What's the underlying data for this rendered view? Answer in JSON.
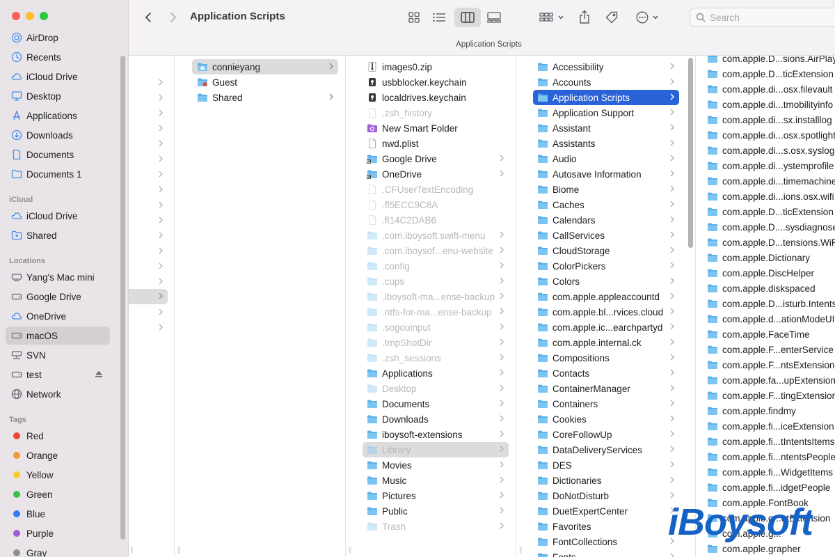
{
  "window": {
    "traffic_colors": [
      "#fe5f57",
      "#febc2e",
      "#28c840"
    ]
  },
  "toolbar": {
    "title": "Application Scripts",
    "path_label": "Application Scripts",
    "search_placeholder": "Search"
  },
  "sidebar": {
    "favorites": [
      {
        "label": "AirDrop",
        "icon": "airdrop-icon"
      },
      {
        "label": "Recents",
        "icon": "clock-icon"
      },
      {
        "label": "iCloud Drive",
        "icon": "cloud-icon"
      },
      {
        "label": "Desktop",
        "icon": "desktop-icon"
      },
      {
        "label": "Applications",
        "icon": "applications-icon"
      },
      {
        "label": "Downloads",
        "icon": "download-icon"
      },
      {
        "label": "Documents",
        "icon": "document-icon"
      },
      {
        "label": "Documents 1",
        "icon": "folder-icon"
      }
    ],
    "icloud_header": "iCloud",
    "icloud": [
      {
        "label": "iCloud Drive",
        "icon": "cloud-icon"
      },
      {
        "label": "Shared",
        "icon": "shared-folder-icon"
      }
    ],
    "locations_header": "Locations",
    "locations": [
      {
        "label": "Yang's Mac mini",
        "icon": "computer-icon"
      },
      {
        "label": "Google Drive",
        "icon": "drive-icon"
      },
      {
        "label": "OneDrive",
        "icon": "cloud-icon"
      },
      {
        "label": "macOS",
        "icon": "disk-icon",
        "selected": true
      },
      {
        "label": "SVN",
        "icon": "network-drive-icon"
      },
      {
        "label": "test",
        "icon": "disk-icon",
        "eject": true
      },
      {
        "label": "Network",
        "icon": "globe-icon"
      }
    ],
    "tags_header": "Tags",
    "tags": [
      {
        "label": "Red",
        "color": "#f0453a"
      },
      {
        "label": "Orange",
        "color": "#f29a2e"
      },
      {
        "label": "Yellow",
        "color": "#f7cb2d"
      },
      {
        "label": "Green",
        "color": "#3dbf4a"
      },
      {
        "label": "Blue",
        "color": "#2f7cf6"
      },
      {
        "label": "Purple",
        "color": "#a25fd6"
      },
      {
        "label": "Gray",
        "color": "#8e8e93"
      }
    ]
  },
  "columns": {
    "users": [
      {
        "label": "connieyang",
        "icon": "home-folder-icon",
        "selected": true,
        "chevron": true
      },
      {
        "label": "Guest",
        "icon": "guest-folder-icon",
        "chevron": false
      },
      {
        "label": "Shared",
        "icon": "folder-icon",
        "chevron": true
      }
    ],
    "home": [
      {
        "label": "images0.zip",
        "icon": "zip-icon",
        "dim": false,
        "chevron": false
      },
      {
        "label": "usbblocker.keychain",
        "icon": "keychain-icon",
        "dim": false,
        "chevron": false
      },
      {
        "label": "localdrives.keychain",
        "icon": "keychain-icon",
        "dim": false,
        "chevron": false
      },
      {
        "label": ".zsh_history",
        "icon": "file-icon",
        "dim": true,
        "chevron": false
      },
      {
        "label": "New Smart Folder",
        "icon": "smart-folder-icon",
        "dim": false,
        "chevron": false
      },
      {
        "label": "nwd.plist",
        "icon": "file-icon",
        "dim": false,
        "chevron": false
      },
      {
        "label": "Google Drive",
        "icon": "alias-folder-icon",
        "dim": false,
        "chevron": true
      },
      {
        "label": "OneDrive",
        "icon": "alias-folder-icon",
        "dim": false,
        "chevron": true
      },
      {
        "label": ".CFUserTextEncoding",
        "icon": "file-icon",
        "dim": true,
        "chevron": false
      },
      {
        "label": ".fl5ECC9C8A",
        "icon": "file-icon",
        "dim": true,
        "chevron": false
      },
      {
        "label": ".fl14C2DAB6",
        "icon": "file-icon",
        "dim": true,
        "chevron": false
      },
      {
        "label": ".com.iboysoft.swift-menu",
        "icon": "folder-icon",
        "dim": true,
        "chevron": true
      },
      {
        "label": ".com.iboysof...enu-website",
        "icon": "folder-icon",
        "dim": true,
        "chevron": true
      },
      {
        "label": ".config",
        "icon": "folder-icon",
        "dim": true,
        "chevron": true
      },
      {
        "label": ".cups",
        "icon": "folder-icon",
        "dim": true,
        "chevron": true
      },
      {
        "label": ".iboysoft-ma...ense-backup",
        "icon": "folder-icon",
        "dim": true,
        "chevron": true
      },
      {
        "label": ".ntfs-for-ma...ense-backup",
        "icon": "folder-icon",
        "dim": true,
        "chevron": true
      },
      {
        "label": ".sogouinput",
        "icon": "folder-icon",
        "dim": true,
        "chevron": true
      },
      {
        "label": ".tmpShotDir",
        "icon": "folder-icon",
        "dim": true,
        "chevron": true
      },
      {
        "label": ".zsh_sessions",
        "icon": "folder-icon",
        "dim": true,
        "chevron": true
      },
      {
        "label": "Applications",
        "icon": "folder-icon",
        "dim": false,
        "chevron": true
      },
      {
        "label": "Desktop",
        "icon": "folder-icon",
        "dim": true,
        "chevron": true
      },
      {
        "label": "Documents",
        "icon": "folder-icon",
        "dim": false,
        "chevron": true
      },
      {
        "label": "Downloads",
        "icon": "folder-icon",
        "dim": false,
        "chevron": true
      },
      {
        "label": "iboysoft-extensions",
        "icon": "folder-icon",
        "dim": false,
        "chevron": true
      },
      {
        "label": "Library",
        "icon": "folder-icon",
        "dim": true,
        "selected": true,
        "chevron": true
      },
      {
        "label": "Movies",
        "icon": "folder-icon",
        "dim": false,
        "chevron": true
      },
      {
        "label": "Music",
        "icon": "folder-icon",
        "dim": false,
        "chevron": true
      },
      {
        "label": "Pictures",
        "icon": "folder-icon",
        "dim": false,
        "chevron": true
      },
      {
        "label": "Public",
        "icon": "folder-icon",
        "dim": false,
        "chevron": true
      },
      {
        "label": "Trash",
        "icon": "folder-icon",
        "dim": true,
        "chevron": true
      }
    ],
    "library": [
      "Accessibility",
      "Accounts",
      "Application Scripts",
      "Application Support",
      "Assistant",
      "Assistants",
      "Audio",
      "Autosave Information",
      "Biome",
      "Caches",
      "Calendars",
      "CallServices",
      "CloudStorage",
      "ColorPickers",
      "Colors",
      "com.apple.appleaccountd",
      "com.apple.bl...rvices.cloud",
      "com.apple.ic...earchpartyd",
      "com.apple.internal.ck",
      "Compositions",
      "Contacts",
      "ContainerManager",
      "Containers",
      "Cookies",
      "CoreFollowUp",
      "DataDeliveryServices",
      "DES",
      "Dictionaries",
      "DoNotDisturb",
      "DuetExpertCenter",
      "Favorites",
      "FontCollections",
      "Fonts"
    ],
    "library_selected_index": 2,
    "scripts": [
      "com.apple.D...sions.AirPlay",
      "com.apple.D...ticExtension",
      "com.apple.di...osx.filevault",
      "com.apple.di...tmobilityinfo",
      "com.apple.di...sx.installlog",
      "com.apple.di...osx.spotlight",
      "com.apple.di...s.osx.syslog",
      "com.apple.di...ystemprofile",
      "com.apple.di...timemachine",
      "com.apple.di...ions.osx.wifi",
      "com.apple.D...ticExtension",
      "com.apple.D....sysdiagnose",
      "com.apple.D...tensions.WiFi",
      "com.apple.Dictionary",
      "com.apple.DiscHelper",
      "com.apple.diskspaced",
      "com.apple.D...isturb.Intents",
      "com.apple.d...ationModeUI",
      "com.apple.FaceTime",
      "com.apple.F...enterService",
      "com.apple.F...ntsExtension",
      "com.apple.fa...upExtension",
      "com.apple.F...tingExtension",
      "com.apple.findmy",
      "com.apple.fi...iceExtension",
      "com.apple.fi...tIntentsItems",
      "com.apple.fi...ntentsPeople",
      "com.apple.fi...WidgetItems",
      "com.apple.fi...idgetPeople",
      "com.apple.FontBook",
      "com.apple.g...etExtension",
      "com.apple.g...",
      "com.apple.grapher"
    ]
  },
  "watermark": {
    "text": "iBoysoft",
    "color": "#1662c4"
  }
}
